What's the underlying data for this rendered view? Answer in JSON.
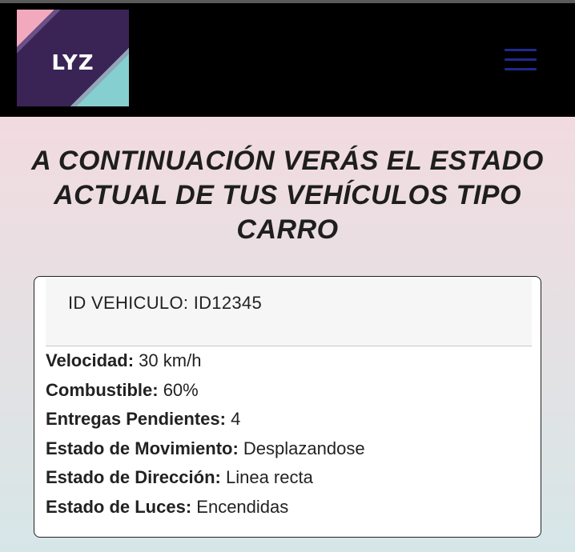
{
  "header": {
    "logo_text": "LYZ",
    "menu_icon": "hamburger-menu-icon",
    "colors": {
      "background": "#000000",
      "menu": "#1f2a8a",
      "logo_dark": "#3a2455",
      "logo_pink": "#f2a9bd",
      "logo_teal": "#85cfd0"
    }
  },
  "main": {
    "title": "A CONTINUACIÓN VERÁS EL ESTADO ACTUAL DE TUS VEHÍCULOS TIPO CARRO"
  },
  "vehicle_card": {
    "id_text": "ID VEHICULO: ID12345",
    "fields": [
      {
        "label": "Velocidad:",
        "value": "30 km/h"
      },
      {
        "label": "Combustible:",
        "value": "60%"
      },
      {
        "label": "Entregas Pendientes:",
        "value": "4"
      },
      {
        "label": "Estado de Movimiento:",
        "value": "Desplazandose"
      },
      {
        "label": "Estado de Dirección:",
        "value": "Linea recta"
      },
      {
        "label": "Estado de Luces:",
        "value": "Encendidas"
      }
    ]
  }
}
